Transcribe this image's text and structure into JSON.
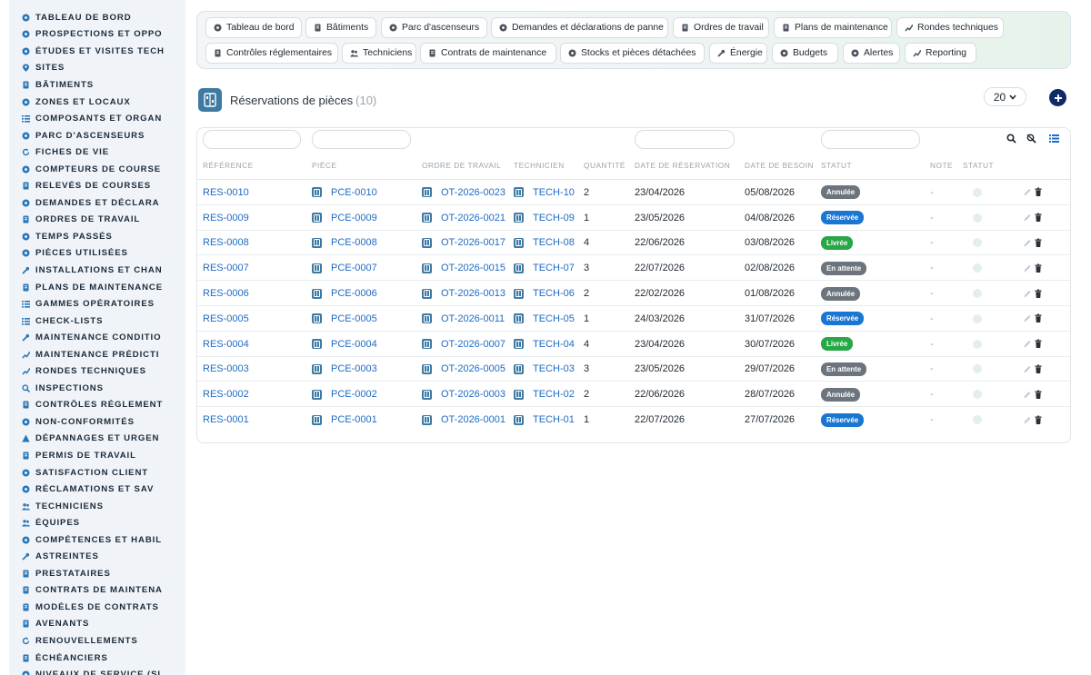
{
  "colors": {
    "accent": "#1f6bc4",
    "sidebar_bg": "#f0f4f8",
    "icon_blue": "#3f7aa3",
    "annulee": "#6c757d",
    "reservee": "#1976d2",
    "livree": "#27a745",
    "en_attente": "#6c757d",
    "add_button": "#0f2a66"
  },
  "sidebar": {
    "items": [
      {
        "label": "TABLEAU DE BORD",
        "icon": "dashboard-icon"
      },
      {
        "label": "PROSPECTIONS ET OPPO",
        "icon": "target-icon"
      },
      {
        "label": "ÉTUDES ET VISITES TECH",
        "icon": "study-icon"
      },
      {
        "label": "SITES",
        "icon": "pin-icon"
      },
      {
        "label": "BÂTIMENTS",
        "icon": "building-icon"
      },
      {
        "label": "ZONES ET LOCAUX",
        "icon": "zone-icon"
      },
      {
        "label": "COMPOSANTS ET ORGAN",
        "icon": "sitemap-icon"
      },
      {
        "label": "PARC D'ASCENSEURS",
        "icon": "elevator-icon"
      },
      {
        "label": "FICHES DE VIE",
        "icon": "history-icon"
      },
      {
        "label": "COMPTEURS DE COURSE",
        "icon": "gauge-icon"
      },
      {
        "label": "RELEVÉS DE COURSES",
        "icon": "reading-icon"
      },
      {
        "label": "DEMANDES ET DÉCLARA",
        "icon": "question-icon"
      },
      {
        "label": "ORDRES DE TRAVAIL",
        "icon": "clipboard-icon"
      },
      {
        "label": "TEMPS PASSÉS",
        "icon": "clock-icon"
      },
      {
        "label": "PIÈCES UTILISÉES",
        "icon": "parts-icon"
      },
      {
        "label": "INSTALLATIONS ET CHAN",
        "icon": "wrench-icon"
      },
      {
        "label": "PLANS DE MAINTENANCE",
        "icon": "calendar-icon"
      },
      {
        "label": "GAMMES OPÉRATOIRES",
        "icon": "list-ordered-icon"
      },
      {
        "label": "CHECK-LISTS",
        "icon": "checklist-icon"
      },
      {
        "label": "MAINTENANCE CONDITIO",
        "icon": "thermometer-icon"
      },
      {
        "label": "MAINTENANCE PRÉDICTI",
        "icon": "chart-icon"
      },
      {
        "label": "RONDES TECHNIQUES",
        "icon": "route-icon"
      },
      {
        "label": "INSPECTIONS",
        "icon": "search-icon"
      },
      {
        "label": "CONTRÔLES RÉGLEMENT",
        "icon": "clipboard-check-icon"
      },
      {
        "label": "NON-CONFORMITÉS",
        "icon": "alert-circle-icon"
      },
      {
        "label": "DÉPANNAGES ET URGEN",
        "icon": "warning-icon"
      },
      {
        "label": "PERMIS DE TRAVAIL",
        "icon": "permit-icon"
      },
      {
        "label": "SATISFACTION CLIENT",
        "icon": "smile-icon"
      },
      {
        "label": "RÉCLAMATIONS ET SAV",
        "icon": "comment-icon"
      },
      {
        "label": "TECHNICIENS",
        "icon": "technician-icon"
      },
      {
        "label": "ÉQUIPES",
        "icon": "users-icon"
      },
      {
        "label": "COMPÉTENCES ET HABIL",
        "icon": "certificate-icon"
      },
      {
        "label": "ASTREINTES",
        "icon": "phone-icon"
      },
      {
        "label": "PRESTATAIRES",
        "icon": "contractor-icon"
      },
      {
        "label": "CONTRATS DE MAINTENA",
        "icon": "contract-icon"
      },
      {
        "label": "MODÈLES DE CONTRATS",
        "icon": "template-icon"
      },
      {
        "label": "AVENANTS",
        "icon": "edit-file-icon"
      },
      {
        "label": "RENOUVELLEMENTS",
        "icon": "refresh-icon"
      },
      {
        "label": "ÉCHÉANCIERS",
        "icon": "schedule-icon"
      },
      {
        "label": "NIVEAUX DE SERVICE (SL",
        "icon": "sla-icon"
      }
    ]
  },
  "nav": {
    "tabs": [
      {
        "label": "Tableau de bord",
        "icon": "dashboard-icon"
      },
      {
        "label": "Bâtiments",
        "icon": "building-icon"
      },
      {
        "label": "Parc d'ascenseurs",
        "icon": "cogs-icon"
      },
      {
        "label": "Demandes et déclarations de panne",
        "icon": "question-icon"
      },
      {
        "label": "Ordres de travail",
        "icon": "clipboard-icon"
      },
      {
        "label": "Plans de maintenance",
        "icon": "calendar-icon"
      },
      {
        "label": "Rondes techniques",
        "icon": "route-icon"
      },
      {
        "label": "Contrôles réglementaires",
        "icon": "clipboard-check-icon"
      },
      {
        "label": "Techniciens",
        "icon": "hardhat-icon"
      },
      {
        "label": "Contrats de maintenance",
        "icon": "contract-icon"
      },
      {
        "label": "Stocks et pièces détachées",
        "icon": "boxes-icon"
      },
      {
        "label": "Énergie",
        "icon": "bolt-icon"
      },
      {
        "label": "Budgets",
        "icon": "money-icon"
      },
      {
        "label": "Alertes",
        "icon": "bell-icon"
      },
      {
        "label": "Reporting",
        "icon": "pie-icon"
      }
    ]
  },
  "page": {
    "title": "Réservations de pièces",
    "count": "(10)",
    "page_size": "20"
  },
  "table": {
    "headers": [
      "RÉFÉRENCE",
      "PIÈCE",
      "ORDRE DE TRAVAIL",
      "TECHNICIEN",
      "QUANTITÉ",
      "DATE DE RÉSERVATION",
      "DATE DE BESOIN",
      "STATUT",
      "NOTE",
      "STATUT"
    ],
    "rows": [
      {
        "ref": "RES-0010",
        "piece": "PCE-0010",
        "ot": "OT-2026-0023",
        "tech": "TECH-10",
        "qty": "2",
        "date_res": "23/04/2026",
        "date_besoin": "05/08/2026",
        "statut": "Annulée",
        "statut_key": "annulee",
        "note": "-"
      },
      {
        "ref": "RES-0009",
        "piece": "PCE-0009",
        "ot": "OT-2026-0021",
        "tech": "TECH-09",
        "qty": "1",
        "date_res": "23/05/2026",
        "date_besoin": "04/08/2026",
        "statut": "Réservée",
        "statut_key": "reservee",
        "note": "-"
      },
      {
        "ref": "RES-0008",
        "piece": "PCE-0008",
        "ot": "OT-2026-0017",
        "tech": "TECH-08",
        "qty": "4",
        "date_res": "22/06/2026",
        "date_besoin": "03/08/2026",
        "statut": "Livrée",
        "statut_key": "livree",
        "note": "-"
      },
      {
        "ref": "RES-0007",
        "piece": "PCE-0007",
        "ot": "OT-2026-0015",
        "tech": "TECH-07",
        "qty": "3",
        "date_res": "22/07/2026",
        "date_besoin": "02/08/2026",
        "statut": "En attente",
        "statut_key": "en_attente",
        "note": "-"
      },
      {
        "ref": "RES-0006",
        "piece": "PCE-0006",
        "ot": "OT-2026-0013",
        "tech": "TECH-06",
        "qty": "2",
        "date_res": "22/02/2026",
        "date_besoin": "01/08/2026",
        "statut": "Annulée",
        "statut_key": "annulee",
        "note": "-"
      },
      {
        "ref": "RES-0005",
        "piece": "PCE-0005",
        "ot": "OT-2026-0011",
        "tech": "TECH-05",
        "qty": "1",
        "date_res": "24/03/2026",
        "date_besoin": "31/07/2026",
        "statut": "Réservée",
        "statut_key": "reservee",
        "note": "-"
      },
      {
        "ref": "RES-0004",
        "piece": "PCE-0004",
        "ot": "OT-2026-0007",
        "tech": "TECH-04",
        "qty": "4",
        "date_res": "23/04/2026",
        "date_besoin": "30/07/2026",
        "statut": "Livrée",
        "statut_key": "livree",
        "note": "-"
      },
      {
        "ref": "RES-0003",
        "piece": "PCE-0003",
        "ot": "OT-2026-0005",
        "tech": "TECH-03",
        "qty": "3",
        "date_res": "23/05/2026",
        "date_besoin": "29/07/2026",
        "statut": "En attente",
        "statut_key": "en_attente",
        "note": "-"
      },
      {
        "ref": "RES-0002",
        "piece": "PCE-0002",
        "ot": "OT-2026-0003",
        "tech": "TECH-02",
        "qty": "2",
        "date_res": "22/06/2026",
        "date_besoin": "28/07/2026",
        "statut": "Annulée",
        "statut_key": "annulee",
        "note": "-"
      },
      {
        "ref": "RES-0001",
        "piece": "PCE-0001",
        "ot": "OT-2026-0001",
        "tech": "TECH-01",
        "qty": "1",
        "date_res": "22/07/2026",
        "date_besoin": "27/07/2026",
        "statut": "Réservée",
        "statut_key": "reservee",
        "note": "-"
      }
    ]
  }
}
